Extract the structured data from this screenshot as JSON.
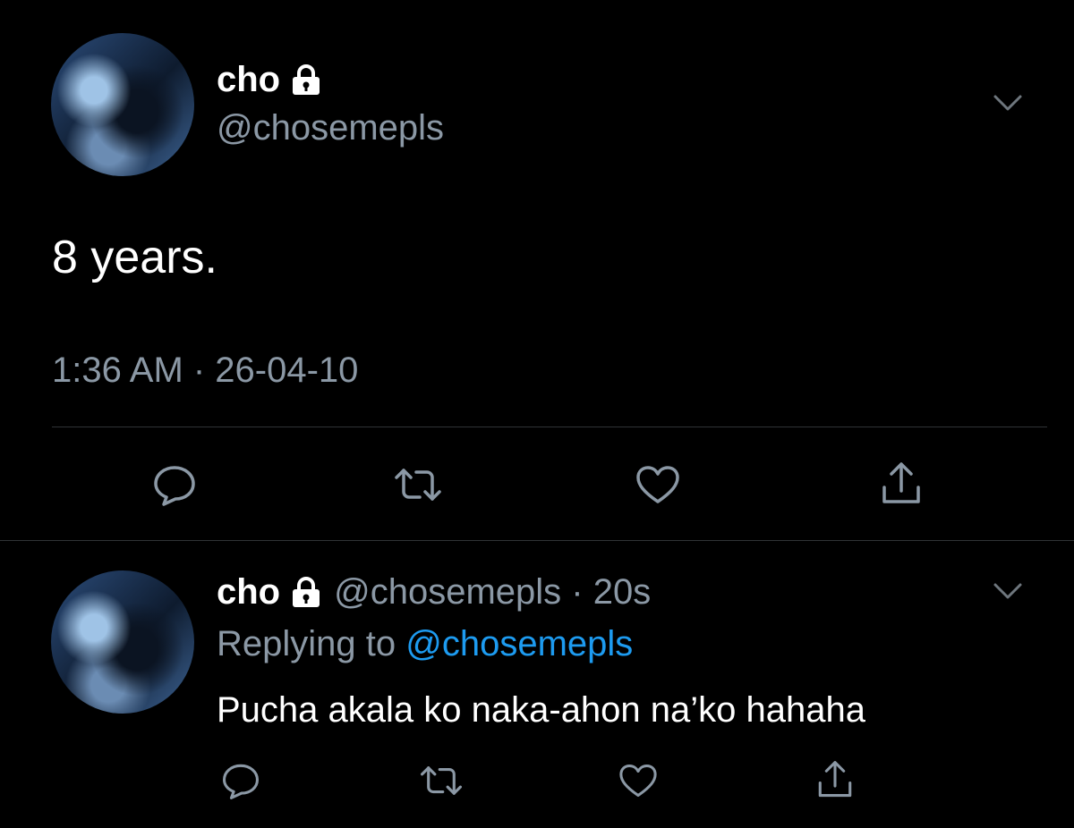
{
  "main_tweet": {
    "display_name": "cho",
    "handle": "@chosemepls",
    "text": "8 years.",
    "timestamp": "1:36 AM · 26-04-10"
  },
  "reply_tweet": {
    "display_name": "cho",
    "handle_time": "@chosemepls · 20s",
    "replying_prefix": "Replying to ",
    "replying_handle": "@chosemepls",
    "text": "Pucha akala ko naka-ahon na’ko hahaha"
  },
  "colors": {
    "background": "#000000",
    "muted_text": "#8b98a5",
    "link": "#1d9bf0",
    "divider": "#2f3336"
  },
  "icons": [
    "lock-icon",
    "chevron-down-icon",
    "reply-icon",
    "retweet-icon",
    "like-icon",
    "share-icon"
  ]
}
